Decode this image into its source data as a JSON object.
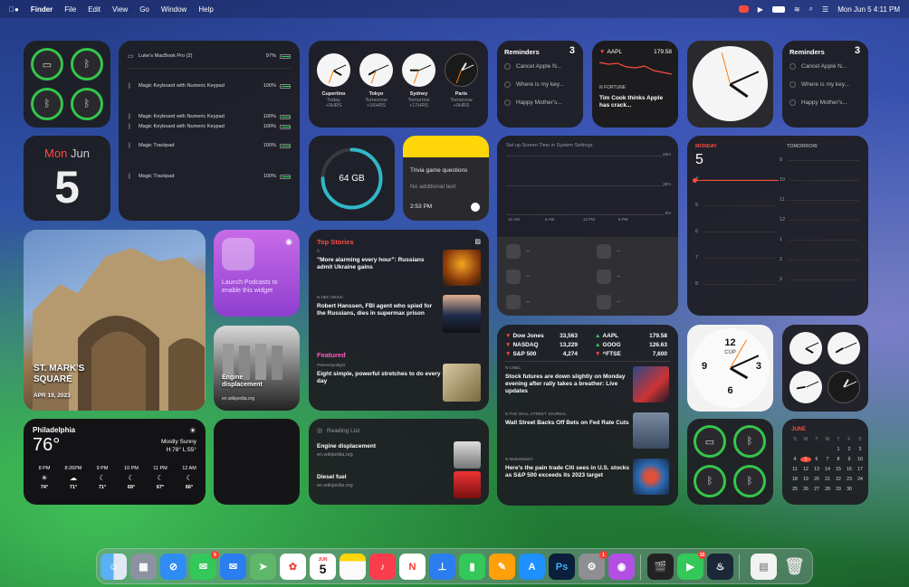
{
  "menubar": {
    "app": "Finder",
    "items": [
      "File",
      "Edit",
      "View",
      "Go",
      "Window",
      "Help"
    ],
    "clock": "Mon Jun 5  4:11 PM"
  },
  "batteries": {
    "rows": [
      {
        "name": "Luke's MacBook Pro (2)",
        "pct": "97%",
        "level": 0.97
      },
      {
        "name": "Magic Keyboard with Numeric Keypad",
        "pct": "100%",
        "level": 1.0
      },
      {
        "name": "Magic Keyboard with Numeric Keypad",
        "pct": "100%",
        "level": 1.0
      },
      {
        "name": "Magic Trackpad",
        "pct": "100%",
        "level": 1.0
      },
      {
        "name": "Magic Trackpad",
        "pct": "100%",
        "level": 1.0
      }
    ]
  },
  "worldclock": [
    {
      "city": "Cupertino",
      "day": "Today",
      "offset": "+0HRS"
    },
    {
      "city": "Tokyo",
      "day": "Tomorrow",
      "offset": "+16HRS"
    },
    {
      "city": "Sydney",
      "day": "Tomorrow",
      "offset": "+17HRS"
    },
    {
      "city": "Paris",
      "day": "Tomorrow",
      "offset": "+9HRS"
    }
  ],
  "reminders": {
    "title": "Reminders",
    "count": "3",
    "items": [
      "Cancel Apple N...",
      "Where is my key...",
      "Happy Mother's..."
    ]
  },
  "stock_card": {
    "ticker": "AAPL",
    "price": "179.58",
    "source": "FORTUNE",
    "headline": "Tim Cook thinks Apple has crack..."
  },
  "calendar_small": {
    "weekday": "Mon",
    "month": "Jun",
    "day": "5"
  },
  "storage": {
    "label": "64 GB",
    "fraction": 0.75
  },
  "notes": {
    "title": "Trivia game questions",
    "subtitle": "No additional text",
    "time": "2:53 PM"
  },
  "screentime": {
    "title": "Set up Screen Time in System Settings.",
    "y": [
      "60m",
      "30m",
      "0m"
    ],
    "x": [
      "12 AM",
      "6 AM",
      "12 PM",
      "6 PM"
    ],
    "dashes": [
      "--",
      "--",
      "--",
      "--",
      "--",
      "--"
    ]
  },
  "calendar_big": {
    "today_label": "MONDAY",
    "today": "5",
    "tomorrow_label": "TOMORROW",
    "hours": [
      "9",
      "10",
      "11",
      "12",
      "1",
      "2",
      "3"
    ],
    "left_hours": [
      "4",
      "5",
      "6",
      "7",
      "8"
    ]
  },
  "photo": {
    "title": "ST. MARK'S SQUARE",
    "date": "APR 19, 2023"
  },
  "podcasts": {
    "text": "Launch Podcasts to enable this widget"
  },
  "engine_photo": {
    "title": "Engine displacement",
    "source": "en.wikipedia.org"
  },
  "news": {
    "section1": "Top Stories",
    "s1_source": "©",
    "s1_head": "\"More alarming every hour\": Russians admit Ukraine gains",
    "s2_source": "NBC NEWS",
    "s2_head": "Robert Hanssen, FBI agent who spied for the Russians, dies in supermax prison",
    "section2": "Featured",
    "s3_source": "#NewsSpotlight",
    "s3_head": "Eight simple, powerful stretches to do every day"
  },
  "stocks_list": {
    "left": [
      {
        "name": "Dow Jones",
        "val": "33,563",
        "dir": "down"
      },
      {
        "name": "NASDAQ",
        "val": "13,229",
        "dir": "down"
      },
      {
        "name": "S&P 500",
        "val": "4,274",
        "dir": "down"
      }
    ],
    "right": [
      {
        "name": "AAPL",
        "val": "179.58",
        "dir": "up"
      },
      {
        "name": "GOOG",
        "val": "126.63",
        "dir": "up"
      },
      {
        "name": "^FTSE",
        "val": "7,600",
        "dir": "down"
      }
    ],
    "n1_source": "CNBC",
    "n1_head": "Stock futures are down slightly on Monday evening after rally takes a breather: Live updates",
    "n2_source": "THE WALL STREET JOURNAL",
    "n2_head": "Wall Street Backs Off Bets on Fed Rate Cuts",
    "n3_source": "MarketWatch",
    "n3_head": "Here's the pain trade Citi sees in U.S. stocks as S&P 500 exceeds its 2023 target"
  },
  "weather": {
    "city": "Philadelphia",
    "temp": "76°",
    "cond": "Mostly Sunny",
    "hl": "H:78° L:55°",
    "hours": [
      {
        "t": "8 PM",
        "v": "74°",
        "i": "☀"
      },
      {
        "t": "8:26PM",
        "v": "71°",
        "i": "☁"
      },
      {
        "t": "9 PM",
        "v": "71°",
        "i": "☾"
      },
      {
        "t": "10 PM",
        "v": "69°",
        "i": "☾"
      },
      {
        "t": "11 PM",
        "v": "67°",
        "i": "☾"
      },
      {
        "t": "12 AM",
        "v": "66°",
        "i": "☾"
      }
    ]
  },
  "reading": {
    "title": "Reading List",
    "i1": "Engine displacement",
    "i1s": "en.wikipedia.org",
    "i2": "Diesel fuel",
    "i2s": "en.wikipedia.org"
  },
  "bigclock": {
    "numbers": [
      "12",
      "3",
      "6",
      "9"
    ],
    "city": "CUP"
  },
  "month_cal": {
    "month": "JUNE",
    "heads": [
      "S",
      "M",
      "T",
      "W",
      "T",
      "F",
      "S"
    ],
    "days": [
      "",
      "",
      "",
      "",
      "1",
      "2",
      "3",
      "4",
      "5",
      "6",
      "7",
      "8",
      "9",
      "10",
      "11",
      "12",
      "13",
      "14",
      "15",
      "16",
      "17",
      "18",
      "19",
      "20",
      "21",
      "22",
      "23",
      "24",
      "25",
      "26",
      "27",
      "28",
      "29",
      "30",
      ""
    ],
    "today": "5"
  },
  "dock": {
    "calendar_month": "JUN",
    "calendar_day": "5",
    "badges": {
      "messages": "5",
      "settings": "1",
      "facetime": "15"
    }
  }
}
